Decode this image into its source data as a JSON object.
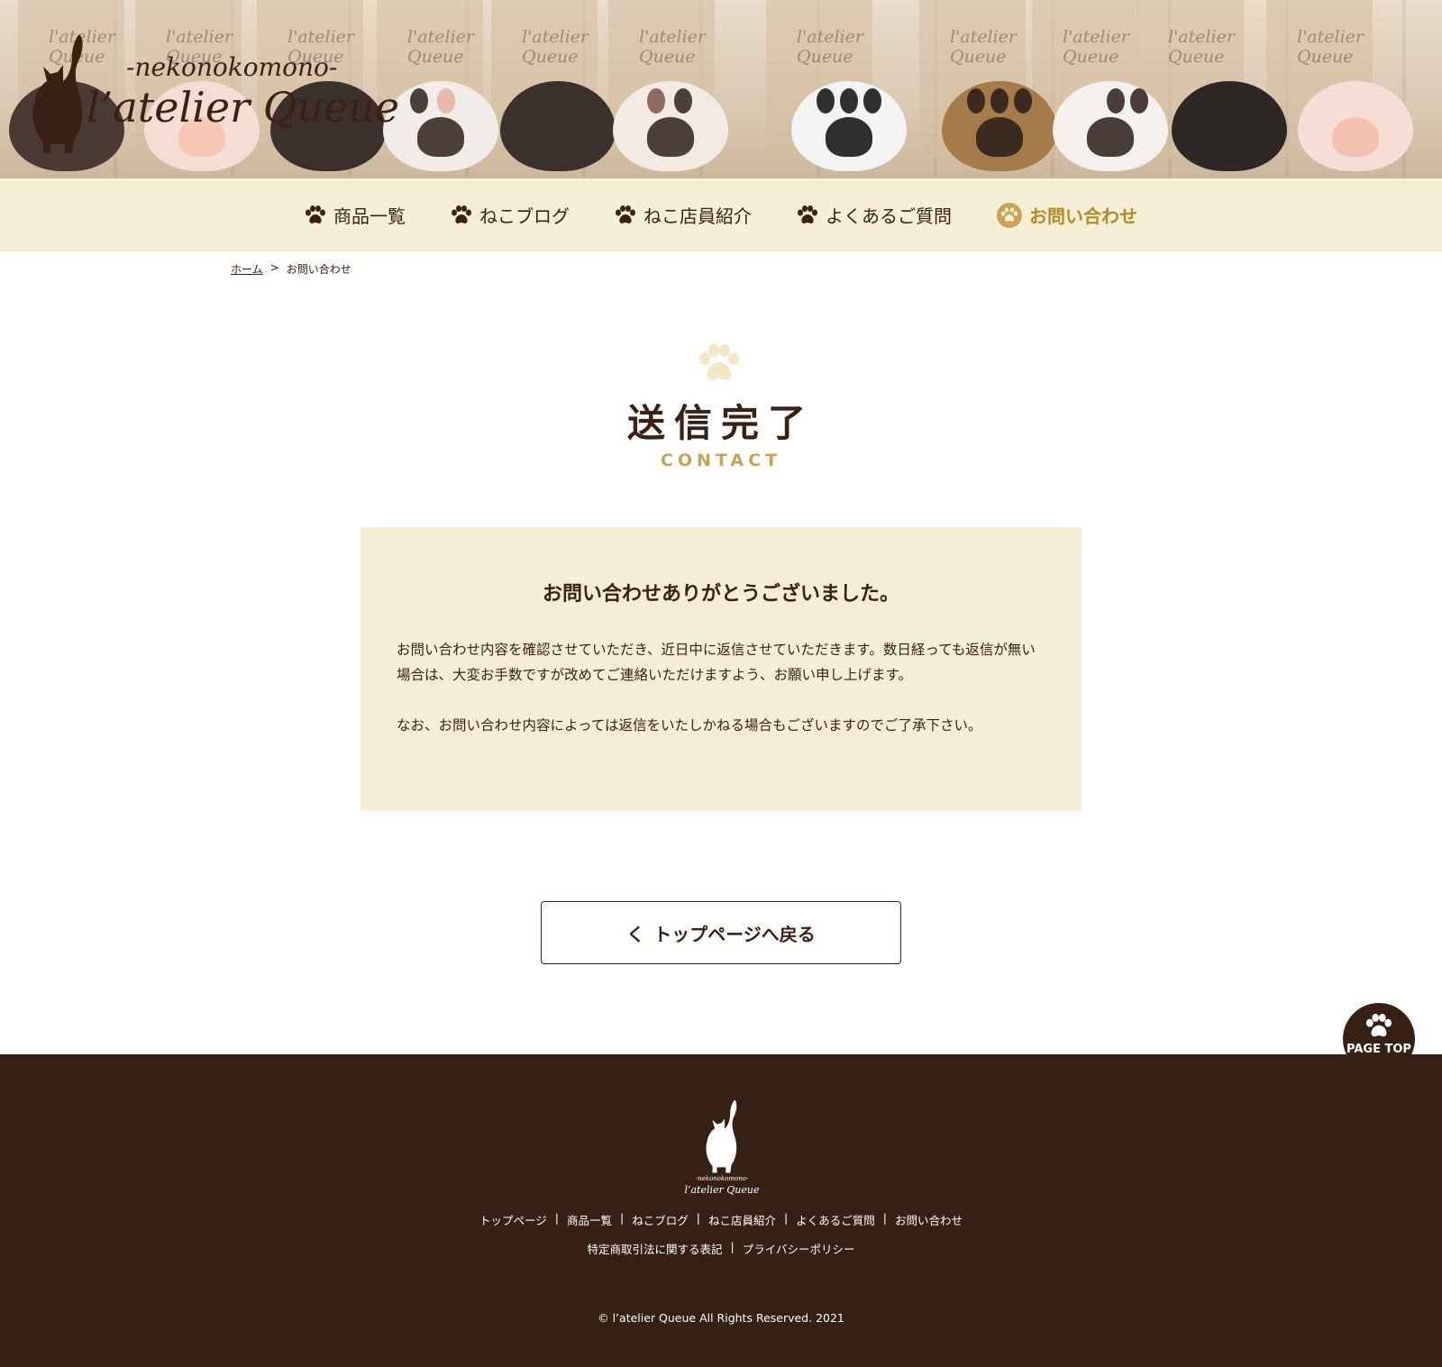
{
  "header": {
    "logo_sub": "-nekonokomono-",
    "logo_main": "l’atelier Queue",
    "product_card_label": "l'atelier Queue"
  },
  "nav": {
    "items": [
      {
        "label": "商品一覧",
        "icon": "paw-icon"
      },
      {
        "label": "ねこブログ",
        "icon": "paw-icon"
      },
      {
        "label": "ねこ店員紹介",
        "icon": "paw-icon"
      },
      {
        "label": "よくあるご質問",
        "icon": "paw-icon"
      },
      {
        "label": "お問い合わせ",
        "icon": "paw-circle-icon",
        "active": true
      }
    ],
    "active_color": "#b08a2a"
  },
  "breadcrumb": {
    "home": "ホーム",
    "separator": ">",
    "current": "お問い合わせ"
  },
  "page": {
    "title": "送信完了",
    "subtitle": "CONTACT",
    "subtitle_color": "#c7a356"
  },
  "message": {
    "heading": "お問い合わせありがとうございました。",
    "paragraph1": "お問い合わせ内容を確認させていただき、近日中に返信させていただきます。数日経っても返信が無い場合は、大変お手数ですが改めてご連絡いただけますよう、お願い申し上げます。",
    "paragraph2": "なお、お問い合わせ内容によっては返信をいたしかねる場合もございますのでご了承下さい。"
  },
  "back_button": {
    "chevron": "く",
    "label": "トップページへ戻る"
  },
  "page_top": {
    "label": "PAGE TOP"
  },
  "footer": {
    "logo_sub": "-nekonokomono-",
    "logo_main": "l’atelier Queue",
    "links_row1": [
      "トップページ",
      "商品一覧",
      "ねこブログ",
      "ねこ店員紹介",
      "よくあるご質問",
      "お問い合わせ"
    ],
    "links_row2": [
      "特定商取引法に関する表記",
      "プライバシーポリシー"
    ],
    "separator": "|",
    "copyright": "© l’atelier Queue All Rights Reserved. 2021",
    "background": "#361f13"
  },
  "colors": {
    "text": "#3a2114",
    "nav_bg": "#f5efd6",
    "box_bg": "#f5eed6"
  }
}
